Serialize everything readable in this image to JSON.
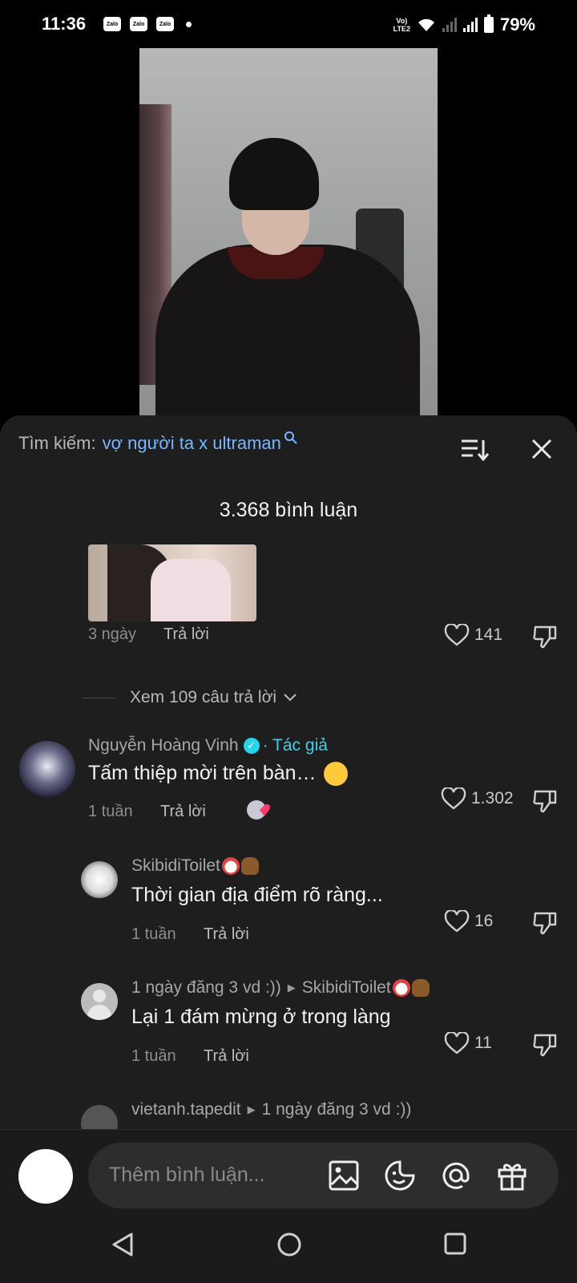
{
  "status_bar": {
    "time": "11:36",
    "notifications": [
      "Zalo",
      "Zalo",
      "Zalo"
    ],
    "volte": "VoLTE2",
    "battery": "79%"
  },
  "sheet": {
    "search_label": "Tìm kiếm:",
    "search_query": "vợ người ta x ultraman",
    "comment_count": "3.368 bình luận"
  },
  "top_comment": {
    "time": "3 ngày",
    "reply_label": "Trả lời",
    "likes": "141",
    "view_replies": "Xem 109 câu trả lời"
  },
  "comments": [
    {
      "username": "Nguyễn Hoàng Vinh",
      "author_tag": "· Tác giả",
      "text": "Tấm thiệp mời trên bàn…",
      "time": "1 tuần",
      "reply_label": "Trả lời",
      "likes": "1.302"
    },
    {
      "username": "SkibidiToilet",
      "text": "Thời gian địa điểm rõ ràng...",
      "time": "1 tuần",
      "reply_label": "Trả lời",
      "likes": "16"
    },
    {
      "username": "1 ngày đăng 3 vd :))",
      "reply_to": "SkibidiToilet",
      "text": "Lại 1 đám mừng ở trong làng",
      "time": "1 tuần",
      "reply_label": "Trả lời",
      "likes": "11"
    },
    {
      "username": "vietanh.tapedit",
      "reply_to": "1 ngày đăng 3 vd :))"
    }
  ],
  "composer": {
    "placeholder": "Thêm bình luận..."
  },
  "icons": [
    "sort-icon",
    "close-icon",
    "heart-icon",
    "dislike-icon",
    "image-icon",
    "emoji-icon",
    "mention-icon",
    "gift-icon",
    "back-icon",
    "home-icon",
    "recents-icon"
  ]
}
